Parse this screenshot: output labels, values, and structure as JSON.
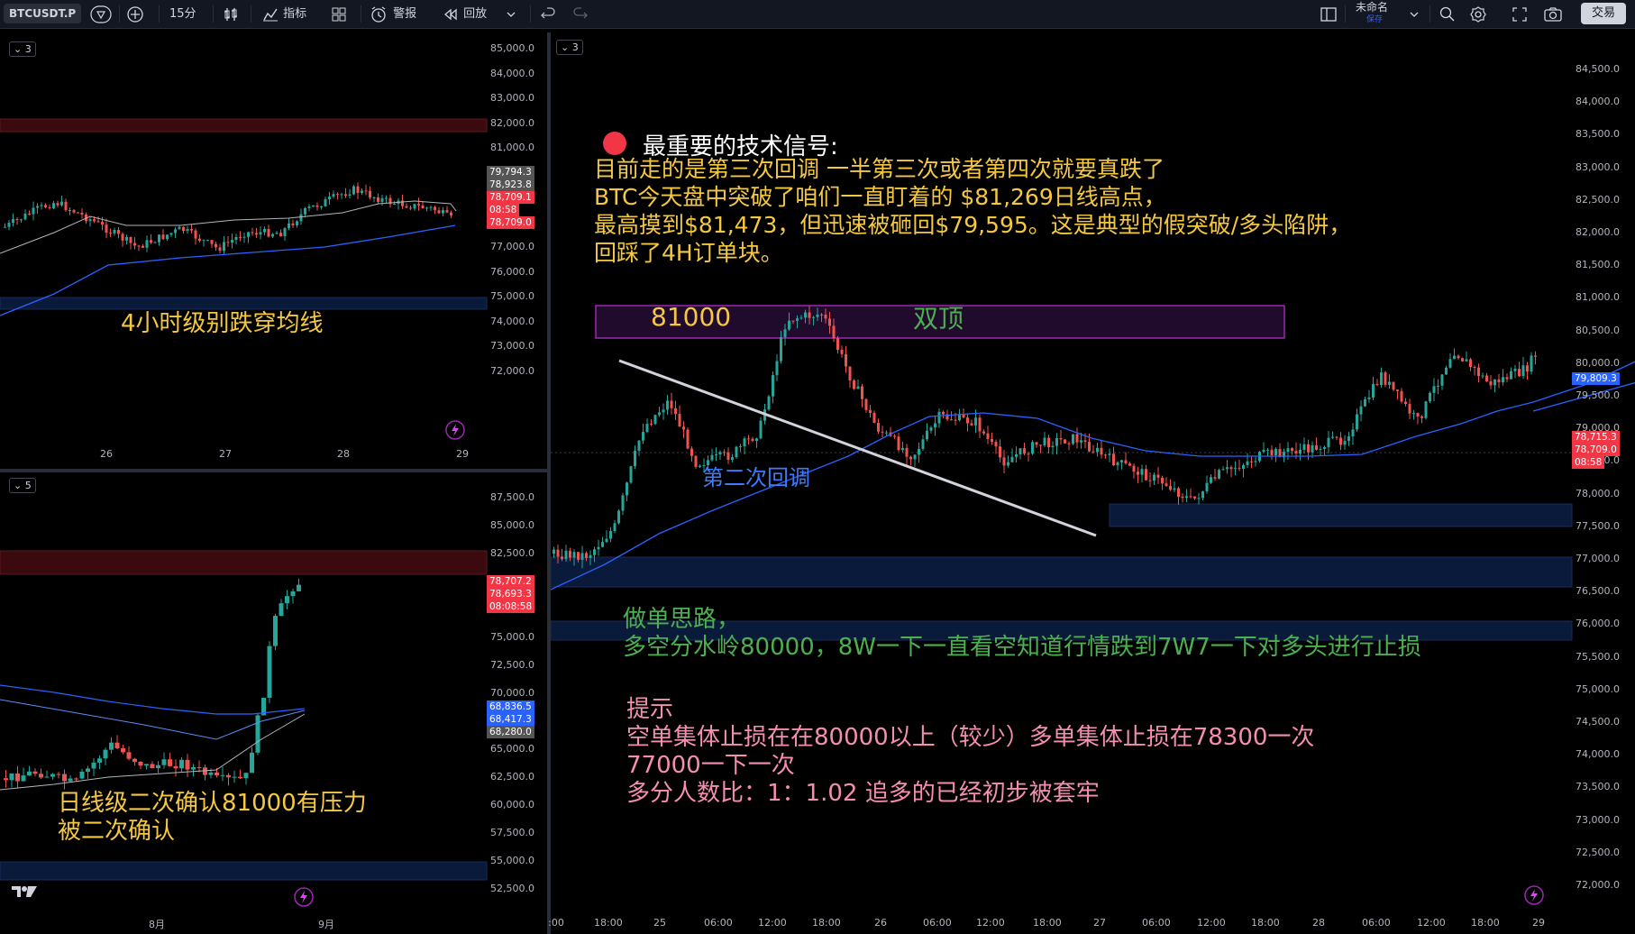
{
  "toolbar": {
    "symbol": "BTCUSDT.P",
    "interval": "15分",
    "indicators": "指标",
    "alert": "警报",
    "replay": "回放",
    "layout_name": "未命名",
    "saved": "保存",
    "trade": "交易"
  },
  "pane_top_left": {
    "badge": "3",
    "price_ticks": [
      "85,000.0",
      "84,000.0",
      "83,000.0",
      "82,000.0",
      "81,000.0",
      "80,000.0",
      "79,000.0",
      "78,000.0",
      "77,000.0",
      "76,000.0",
      "75,000.0",
      "74,000.0",
      "73,000.0",
      "72,000.0"
    ],
    "time_ticks": [
      "26",
      "27",
      "28",
      "29"
    ],
    "tags": [
      "79,794.3",
      "78,923.8",
      "78,709.1",
      "08:58",
      "78,709.0"
    ],
    "annotation": "4小时级别跌穿均线"
  },
  "pane_bottom_left": {
    "badge": "5",
    "price_ticks": [
      "87,500.0",
      "85,000.0",
      "82,500.0",
      "80,000.0",
      "77,500.0",
      "75,000.0",
      "72,500.0",
      "70,000.0",
      "67,500.0",
      "65,000.0",
      "62,500.0",
      "60,000.0",
      "57,500.0",
      "55,000.0",
      "52,500.0"
    ],
    "time_ticks": [
      "8月",
      "9月"
    ],
    "tags": [
      "78,707.2",
      "78,693.3",
      "08:08:58",
      "68,836.5",
      "68,417.3",
      "68,280.0"
    ],
    "annotation_line1": "日线级二次确认81000有压力",
    "annotation_line2": "被二次确认"
  },
  "pane_main": {
    "badge": "3",
    "price_ticks": [
      "84,500.0",
      "84,000.0",
      "83,500.0",
      "83,000.0",
      "82,500.0",
      "82,000.0",
      "81,500.0",
      "81,000.0",
      "80,500.0",
      "80,000.0",
      "79,500.0",
      "79,000.0",
      "78,500.0",
      "78,000.0",
      "77,500.0",
      "77,000.0",
      "76,500.0",
      "76,000.0",
      "75,500.0",
      "75,000.0",
      "74,500.0",
      "74,000.0",
      "73,500.0",
      "73,000.0",
      "72,500.0",
      "72,000.0"
    ],
    "time_ticks": [
      ":00",
      "18:00",
      "25",
      "06:00",
      "12:00",
      "18:00",
      "26",
      "06:00",
      "12:00",
      "18:00",
      "27",
      "06:00",
      "12:00",
      "18:00",
      "28",
      "06:00",
      "12:00",
      "18:00",
      "29"
    ],
    "tags": [
      "79,809.3",
      "78,715.3",
      "78,709.0",
      "08:58"
    ],
    "signal_title": "最重要的技术信号:",
    "signal_lines": [
      "目前走的是第三次回调 一半第三次或者第四次就要真跌了",
      "BTC今天盘中突破了咱们一直盯着的 $81,269日线高点，",
      "最高摸到$81,473，但迅速被砸回$79,595。这是典型的假突破/多头陷阱，",
      "回踩了4H订单块。"
    ],
    "box_label_left": "81000",
    "box_label_mid": "双顶",
    "second_pullback": "第二次回调",
    "plan_lines": [
      "做单思路，",
      "多空分水岭80000，8W一下一直看空知道行情跌到7W7一下对多头进行止损"
    ],
    "tip_lines": [
      "提示",
      "空单集体止损在在80000以上（较少）多单集体止损在78300一次",
      "77000一下一次",
      "多分人数比：1：1.02 追多的已经初步被套牢"
    ]
  },
  "colors": {
    "up": "#26a69a",
    "down": "#ef5350",
    "ma_blue": "#2962ff",
    "annotation_yellow": "#f5c842",
    "plan_green": "#4caf50",
    "tip_pink": "#f48fb1"
  },
  "icons": [
    "plus-circle-icon",
    "bar-chart-icon",
    "indicator-icon",
    "templates-icon",
    "alarm-icon",
    "replay-icon",
    "chevron-down-icon",
    "undo-icon",
    "redo-icon",
    "layout-icon",
    "search-icon",
    "settings-icon",
    "fullscreen-icon",
    "camera-icon",
    "lightning-icon",
    "tradingview-logo-icon"
  ]
}
